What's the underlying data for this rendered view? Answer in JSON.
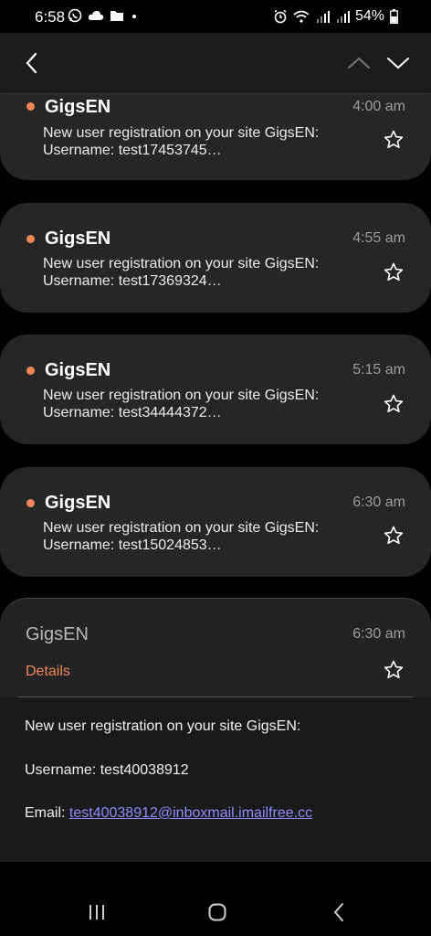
{
  "status_bar": {
    "time": "6:58",
    "battery": "54%",
    "left_icons": [
      "whatsapp-icon",
      "cloud-icon",
      "folder-icon",
      "dot-icon"
    ],
    "right_icons": [
      "alarm-icon",
      "wifi-icon",
      "signal-icon",
      "signal-icon",
      "battery-icon"
    ]
  },
  "toolbar": {
    "back_icon": "back-arrow-icon",
    "up_icon": "chevron-up-icon",
    "down_icon": "chevron-down-icon"
  },
  "colors": {
    "unread_dot": "#f0875a",
    "details": "#f0875a",
    "link": "#8f8cff",
    "card_bg": "#262626"
  },
  "messages": [
    {
      "sender": "GigsEN",
      "time": "4:00 am",
      "line1": "New user registration on your site GigsEN:",
      "line2": "Username: test17453745…"
    },
    {
      "sender": "GigsEN",
      "time": "4:55 am",
      "line1": "New user registration on your site GigsEN:",
      "line2": "Username: test17369324…"
    },
    {
      "sender": "GigsEN",
      "time": "5:15 am",
      "line1": "New user registration on your site GigsEN:",
      "line2": "Username: test34444372…"
    },
    {
      "sender": "GigsEN",
      "time": "6:30 am",
      "line1": "New user registration on your site GigsEN:",
      "line2": "Username: test15024853…"
    }
  ],
  "open_message": {
    "sender": "GigsEN",
    "time": "6:30 am",
    "details_label": "Details",
    "body_line1": "New user registration on your site GigsEN:",
    "username_line": "Username: test40038912",
    "email_label": "Email: ",
    "email_link": "test40038912@inboxmail.imailfree.cc"
  },
  "system_nav": {
    "recents": "recents-icon",
    "home": "home-icon",
    "back": "back-icon"
  }
}
